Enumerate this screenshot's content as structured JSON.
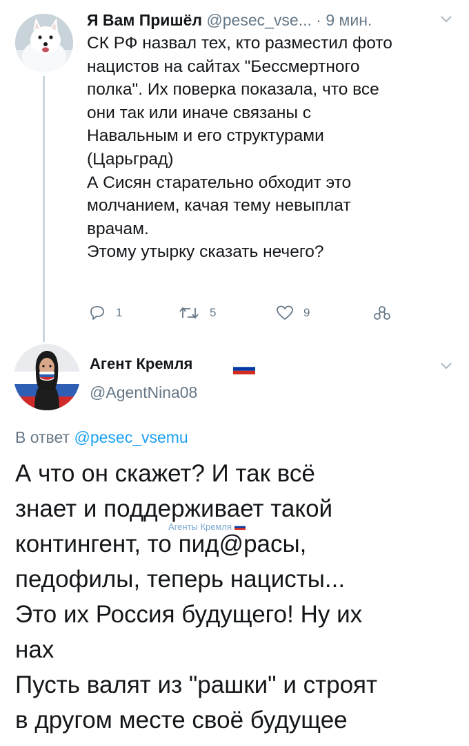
{
  "tweet1": {
    "author_name": "Я Вам Пришёл",
    "handle": "@pesec_vse...",
    "time": "· 9 мин.",
    "text_lines": [
      "СК РФ назвал тех, кто разместил фото",
      "нацистов на сайтах \"Бессмертного",
      "полка\". Их поверка показала, что все",
      "они так или иначе связаны с",
      "Навальным и его структурами",
      "(Царьград)",
      "А Сисян старательно обходит это",
      "молчанием, качая тему невыплат",
      "врачам.",
      "Этому утырку сказать нечего?"
    ],
    "actions": {
      "reply_count": "1",
      "retweet_count": "5",
      "like_count": "9"
    },
    "icons": [
      "avatar-arctic-fox",
      "chevron-down-icon",
      "reply-icon",
      "retweet-icon",
      "like-icon",
      "share-icon"
    ]
  },
  "tweet2": {
    "author_name": "Агент Кремля",
    "handle": "@AgentNina08",
    "reply_prefix": "В ответ ",
    "reply_mention": "@pesec_vsemu",
    "text_lines": [
      "А что он скажет? И так всё",
      "знает и поддерживает такой",
      "контингент, то пид@расы,",
      "педофилы, теперь нацисты...",
      "Это их Россия будущего! Ну их",
      "нах",
      "Пусть валят из \"рашки\" и строят",
      "в другом месте своё будущее"
    ],
    "icons": [
      "avatar-woman-flag",
      "russian-flag-icon",
      "chevron-down-icon"
    ]
  },
  "watermark": {
    "text": "Агенты Кремля"
  },
  "colors": {
    "text": "#14171a",
    "secondary": "#657786",
    "link": "#1da1f2",
    "thread_line": "#ccd6dd",
    "flag_white": "#ffffff",
    "flag_blue": "#0039a6",
    "flag_red": "#d52b1e"
  }
}
